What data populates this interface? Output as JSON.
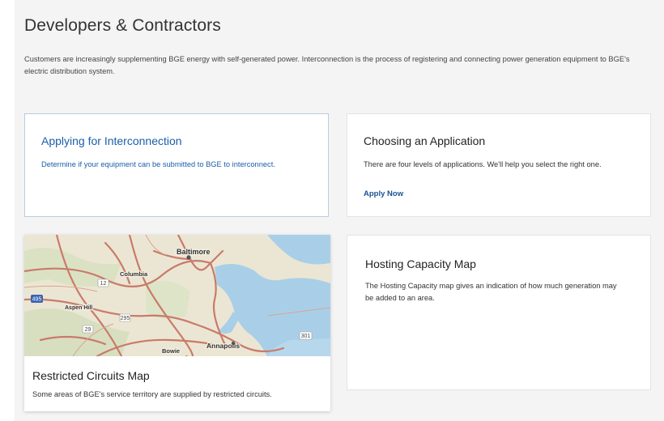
{
  "page": {
    "title": "Developers & Contractors",
    "intro": "Customers are increasingly supplementing BGE energy with self-generated power. Interconnection is the process of registering and connecting power generation equipment to BGE's electric distribution system."
  },
  "cards": {
    "interconnection": {
      "title": "Applying for Interconnection",
      "text": "Determine if your equipment can be submitted to BGE to interconnect."
    },
    "application": {
      "title": "Choosing an Application",
      "text": "There are four levels of applications. We'll help you select the right one.",
      "link": "Apply Now"
    },
    "restricted": {
      "title": "Restricted Circuits Map",
      "text": "Some areas of BGE's service territory are supplied by restricted circuits."
    },
    "hosting": {
      "title": "Hosting Capacity Map",
      "text": "The Hosting Capacity map gives an indication of how much generation may be added to an area."
    }
  },
  "map_labels": {
    "baltimore": "Baltimore",
    "columbia": "Columbia",
    "aspen_hill": "Aspen Hill",
    "bowie": "Bowie",
    "annapolis": "Annapolis",
    "route_12": "12",
    "route_29": "29",
    "route_295": "295",
    "route_495": "495",
    "route_301": "301"
  }
}
